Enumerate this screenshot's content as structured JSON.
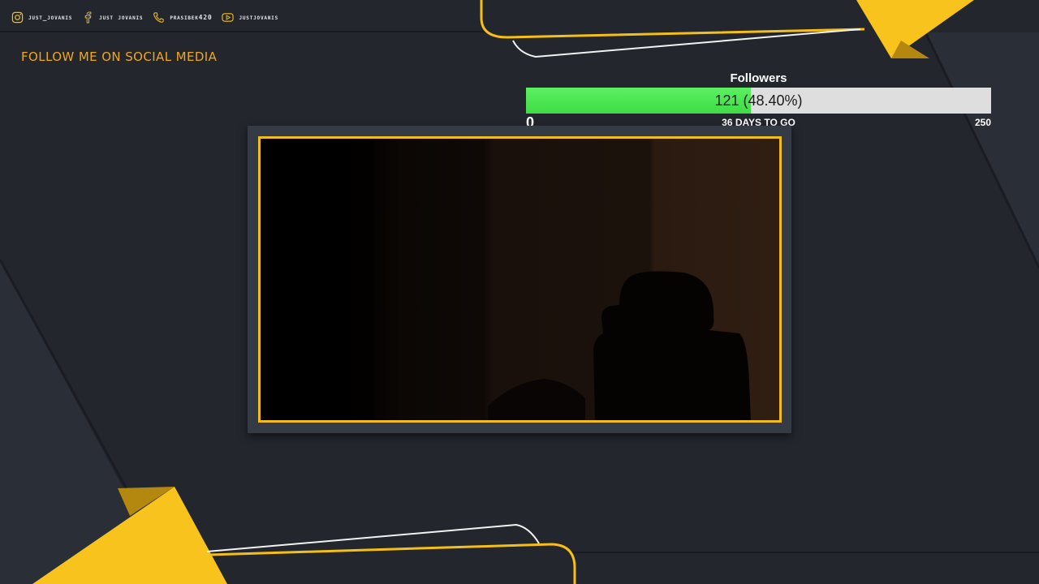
{
  "social": [
    {
      "icon": "instagram-icon",
      "label": "just_jovanis"
    },
    {
      "icon": "facebook-icon",
      "label": "just jovanis"
    },
    {
      "icon": "phone-icon",
      "label": "prasibek420"
    },
    {
      "icon": "youtube-icon",
      "label": "justjovanis"
    }
  ],
  "follow_title": "FOLLOW ME ON SOCIAL MEDIA",
  "followers": {
    "title": "Followers",
    "value_text": "121 (48.40%)",
    "current": 121,
    "goal": 250,
    "progress_fraction": 0.484,
    "min_label": "0",
    "max_label": "250",
    "days_label": "36 DAYS TO GO"
  },
  "colors": {
    "background": "#23262d",
    "accent_yellow": "#f5bf17",
    "title_orange": "#f0a818",
    "progress_green": "#4be350",
    "progress_track": "#dedede",
    "frame": "#353b45"
  }
}
